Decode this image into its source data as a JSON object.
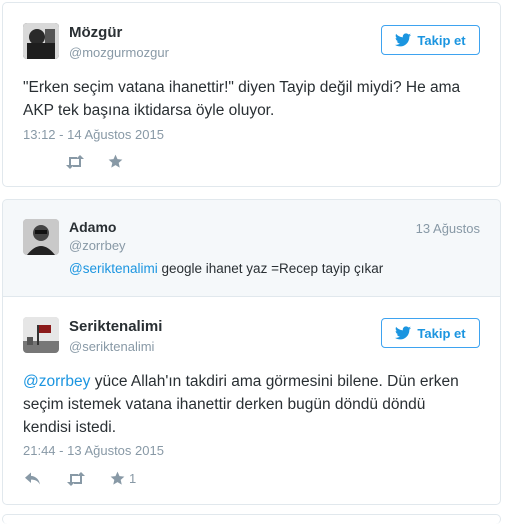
{
  "tweet1": {
    "name": "Mözgür",
    "handle": "@mozgurmozgur",
    "follow_label": "Takip et",
    "text_line1": "\"Erken seçim vatana ihanettir!\" diyen Tayip değil miydi? He ama",
    "text_line2": "AKP tek başına iktidarsa öyle oluyor.",
    "timestamp": "13:12 - 14 Ağustos 2015"
  },
  "reply": {
    "name": "Adamo",
    "handle": "@zorrbey",
    "date": "13 Ağustos",
    "mention": "@seriktenalimi",
    "text": " geogle ihanet yaz =Recep tayip çıkar"
  },
  "tweet2": {
    "name": "Seriktenalimi",
    "handle": "@seriktenalimi",
    "follow_label": "Takip et",
    "mention": "@zorrbey",
    "text_line1_rest": " yüce Allah'ın takdiri ama görmesini bilene. Dün erken",
    "text_line2": "seçim istemek vatana ihanettir derken bugün döndü döndü",
    "text_line3": "kendisi istedi.",
    "timestamp": "21:44 - 13 Ağustos 2015",
    "like_count": "1"
  },
  "icons": [
    "twitter-bird-icon",
    "retweet-icon",
    "star-icon",
    "reply-icon"
  ],
  "colors": {
    "accent": "#1b95e0",
    "muted": "#8899a6",
    "text": "#292f33",
    "border": "#e1e8ed"
  }
}
